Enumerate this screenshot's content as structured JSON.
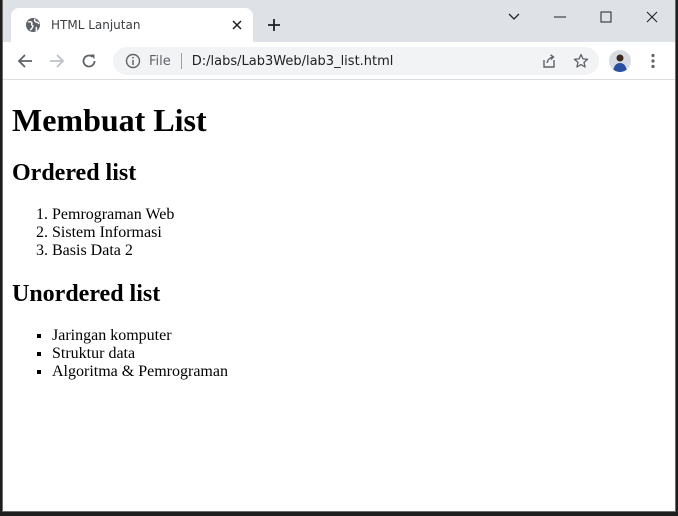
{
  "tab": {
    "title": "HTML Lanjutan"
  },
  "omnibox": {
    "scheme_label": "File",
    "url": "D:/labs/Lab3Web/lab3_list.html"
  },
  "page": {
    "heading": "Membuat List",
    "ordered_heading": "Ordered list",
    "ordered_items": [
      "Pemrograman Web",
      "Sistem Informasi",
      "Basis Data 2"
    ],
    "unordered_heading": "Unordered list",
    "unordered_items": [
      "Jaringan komputer",
      "Struktur data",
      "Algoritma & Pemrograman"
    ]
  },
  "colors": {
    "tabstrip": "#dee1e6",
    "omnibox": "#f1f3f4",
    "icon": "#5f6368"
  },
  "icons": [
    "globe-icon",
    "close-icon",
    "plus-icon",
    "chevron-down-icon",
    "minimize-icon",
    "maximize-icon",
    "window-close-icon",
    "back-arrow-icon",
    "forward-arrow-icon",
    "reload-icon",
    "info-icon",
    "share-icon",
    "star-icon",
    "kebab-menu-icon"
  ]
}
